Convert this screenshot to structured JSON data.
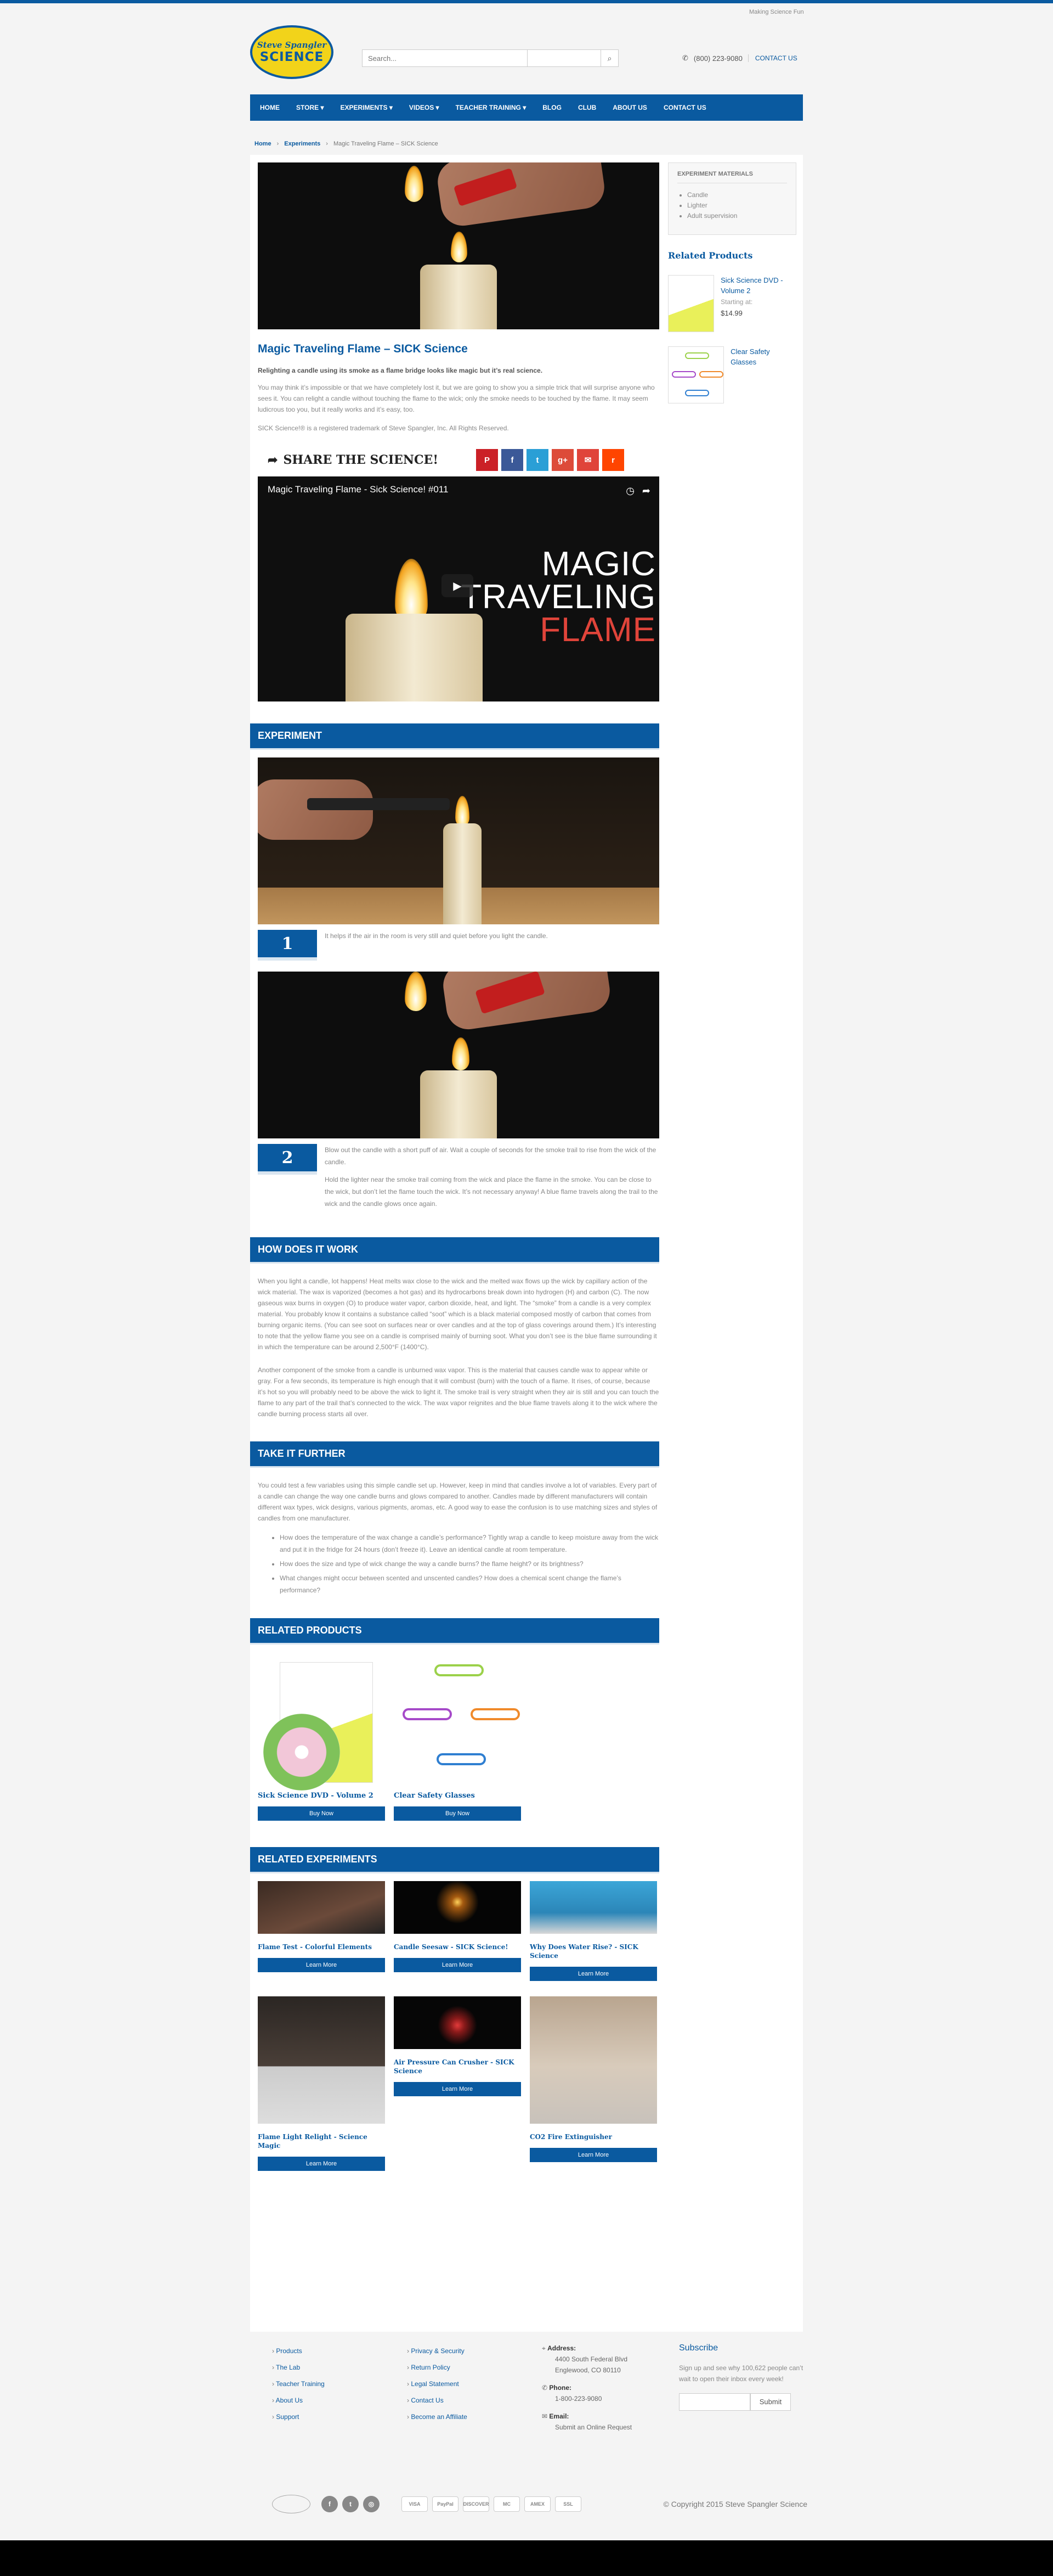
{
  "topbar": {
    "tagline": "Making Science Fun"
  },
  "logo": {
    "line1": "Steve Spangler",
    "line2": "SCIENCE"
  },
  "search": {
    "placeholder": "Search..."
  },
  "header": {
    "phone": "(800) 223-9080",
    "contact": "CONTACT US"
  },
  "nav": [
    "HOME",
    "STORE ▾",
    "EXPERIMENTS ▾",
    "VIDEOS ▾",
    "TEACHER TRAINING ▾",
    "BLOG",
    "CLUB",
    "ABOUT US",
    "CONTACT US"
  ],
  "breadcrumb": {
    "home": "Home",
    "sep": "›",
    "section": "Experiments",
    "current": "Magic Traveling Flame – SICK Science"
  },
  "article": {
    "title": "Magic Traveling Flame – SICK Science",
    "lead": "Relighting a candle using its smoke as a flame bridge looks like magic but it’s real science.",
    "intro": "You may think it’s impossible or that we have completely lost it, but we are going to show you a simple trick that will surprise anyone who sees it. You can relight a candle without touching the flame to the wick; only the smoke needs to be touched by the flame. It may seem ludicrous too you, but it really works and it’s easy, too.",
    "trademark": "SICK Science!® is a registered trademark of Steve Spangler, Inc. All Rights Reserved.",
    "share": "SHARE THE SCIENCE!",
    "video": {
      "title": "Magic Traveling Flame - Sick Science! #011",
      "line1": "MAGIC",
      "line2": "TRAVELING",
      "line3": "FLAME"
    }
  },
  "experiment": {
    "heading": "EXPERIMENT",
    "steps": [
      {
        "num": "1",
        "text": "It helps if the air in the room is very still and quiet before you light the candle."
      },
      {
        "num": "2",
        "text": "Blow out the candle with a short puff of air. Wait a couple of seconds for the smoke trail to rise from the wick of the candle.",
        "text2": "Hold the lighter near the smoke trail coming from the wick and place the flame in the smoke. You can be close to the wick, but don’t let the flame touch the wick. It’s not necessary anyway! A blue flame travels along the trail to the wick and the candle glows once again."
      }
    ]
  },
  "how": {
    "heading": "HOW DOES IT WORK",
    "p1": "When you light a candle, lot happens! Heat melts wax close to the wick and the melted wax flows up the wick by capillary action of the wick material. The wax is vaporized (becomes a hot gas) and its hydrocarbons break down into hydrogen (H) and carbon (C). The now gaseous wax burns in oxygen (O) to produce water vapor, carbon dioxide, heat, and light. The “smoke” from a candle is a very complex material. You probably know it contains a substance called “soot” which is a black material composed mostly of carbon that comes from burning organic items. (You can see soot on surfaces near or over candles and at the top of glass coverings around them.) It’s interesting to note that the yellow flame you see on a candle is comprised mainly of burning soot. What you don’t see is the blue flame surrounding it in which the temperature can be around 2,500°F (1400°C).",
    "p2": "Another component of the smoke from a candle is unburned wax vapor. This is the material that causes candle wax to appear white or gray. For a few seconds, its temperature is high enough that it will combust (burn) with the touch of a flame. It rises, of course, because it’s hot so you will probably need to be above the wick to light it. The smoke trail is very straight when they air is still and you can touch the flame to any part of the trail that’s connected to the wick. The wax vapor reignites and the blue flame travels along it to the wick where the candle burning process starts all over."
  },
  "further": {
    "heading": "TAKE IT FURTHER",
    "p": "You could test a few variables using this simple candle set up. However, keep in mind that candles involve a lot of variables. Every part of a candle can change the way one candle burns and glows compared to another. Candles made by different manufacturers will contain different wax types, wick designs, various pigments, aromas, etc. A good way to ease the confusion is to use matching sizes and styles of candles from one manufacturer.",
    "items": [
      "How does the temperature of the wax change a candle’s performance? Tightly wrap a candle to keep moisture away from the wick and put it in the fridge for 24 hours (don’t freeze it). Leave an identical candle at room temperature.",
      "How does the size and type of wick change the way a candle burns? the flame height? or its brightness?",
      "What changes might occur between scented and unscented candles? How does a chemical scent change the flame’s performance?"
    ]
  },
  "related_products": {
    "heading": "RELATED PRODUCTS",
    "items": [
      {
        "title": "Sick Science DVD - Volume 2",
        "button": "Buy Now"
      },
      {
        "title": "Clear Safety Glasses",
        "button": "Buy Now"
      }
    ]
  },
  "related_experiments": {
    "heading": "RELATED EXPERIMENTS",
    "items": [
      {
        "title": "Flame Test - Colorful Elements",
        "button": "Learn More"
      },
      {
        "title": "Candle Seesaw - SICK Science!",
        "button": "Learn More"
      },
      {
        "title": "Why Does Water Rise? - SICK Science",
        "button": "Learn More"
      },
      {
        "title": "Flame Light Relight - Science Magic",
        "button": "Learn More"
      },
      {
        "title": "Air Pressure Can Crusher - SICK Science",
        "button": "Learn More"
      },
      {
        "title": "CO2 Fire Extinguisher",
        "button": "Learn More"
      }
    ]
  },
  "sidebar": {
    "materials_heading": "EXPERIMENT MATERIALS",
    "materials": [
      "Candle",
      "Lighter",
      "Adult supervision"
    ],
    "related_heading": "Related Products",
    "products": [
      {
        "name": "Sick Science DVD - Volume 2",
        "sub": "Starting at:",
        "price": "$14.99"
      },
      {
        "name": "Clear Safety Glasses"
      }
    ]
  },
  "footer": {
    "col1": [
      "Products",
      "The Lab",
      "Teacher Training",
      "About Us",
      "Support"
    ],
    "col2": [
      "Privacy & Security",
      "Return Policy",
      "Legal Statement",
      "Contact Us",
      "Become an Affiliate"
    ],
    "address_label": "Address:",
    "address1": "4400 South Federal Blvd",
    "address2": "Englewood, CO 80110",
    "phone_label": "Phone:",
    "phone": "1-800-223-9080",
    "email_label": "Email:",
    "email": "Submit an Online Request",
    "subscribe_heading": "Subscribe",
    "subscribe_text": "Sign up and see why 100,622 people can’t wait to open their inbox every week!",
    "subscribe_button": "Submit",
    "payments": [
      "VISA",
      "PayPal",
      "DISCOVER",
      "MC",
      "AMEX",
      "SSL"
    ],
    "copyright": "© Copyright 2015 Steve Spangler Science"
  }
}
